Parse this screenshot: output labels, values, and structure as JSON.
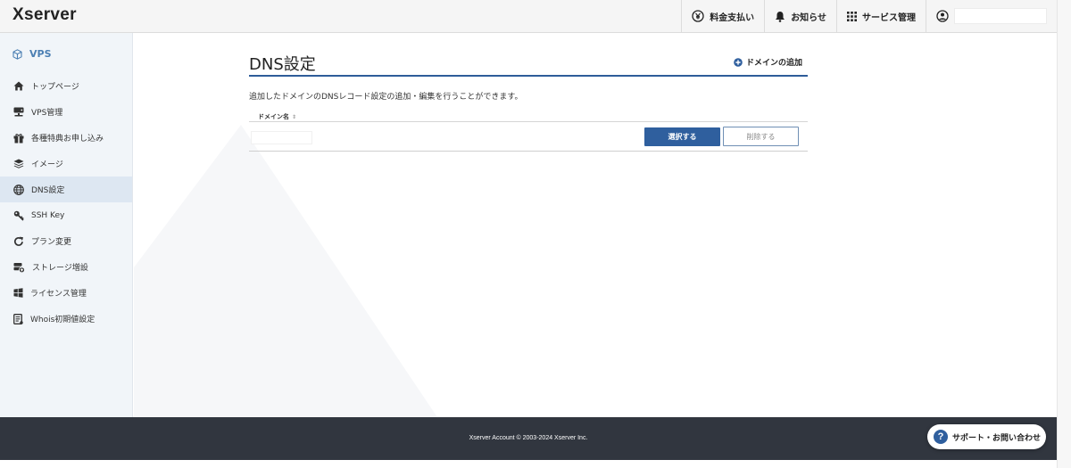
{
  "header": {
    "logo": "Xserver",
    "nav": [
      {
        "label": "料金支払い",
        "icon": "yen-circle-icon"
      },
      {
        "label": "お知らせ",
        "icon": "bell-icon"
      },
      {
        "label": "サービス管理",
        "icon": "grid-icon"
      }
    ],
    "account_icon": "user-circle-icon"
  },
  "sidebar": {
    "title": "VPS",
    "title_icon": "cube-icon",
    "items": [
      {
        "label": "トップページ",
        "icon": "home-icon"
      },
      {
        "label": "VPS管理",
        "icon": "server-icon"
      },
      {
        "label": "各種特典お申し込み",
        "icon": "gift-icon"
      },
      {
        "label": "イメージ",
        "icon": "layers-icon"
      },
      {
        "label": "DNS設定",
        "icon": "globe-icon",
        "active": true
      },
      {
        "label": "SSH Key",
        "icon": "key-icon"
      },
      {
        "label": "プラン変更",
        "icon": "refresh-icon"
      },
      {
        "label": "ストレージ増設",
        "icon": "storage-add-icon"
      },
      {
        "label": "ライセンス管理",
        "icon": "windows-icon"
      },
      {
        "label": "Whois初期値設定",
        "icon": "document-list-icon"
      }
    ]
  },
  "main": {
    "title": "DNS設定",
    "add_domain_label": "ドメインの追加",
    "description": "追加したドメインのDNSレコード設定の追加・編集を行うことができます。",
    "column_header": "ドメイン名",
    "sort_glyph": "⇕",
    "select_button": "選択する",
    "delete_button": "削除する"
  },
  "footer": {
    "copyright": "Xserver Account © 2003-2024 Xserver Inc."
  },
  "support": {
    "label": "サポート・お問い合わせ",
    "icon_glyph": "?"
  },
  "colors": {
    "brand_blue": "#2f5f9e",
    "sidebar_bg": "#f1f5f9",
    "sidebar_active": "#dde7f2",
    "footer_bg": "#31363f"
  }
}
